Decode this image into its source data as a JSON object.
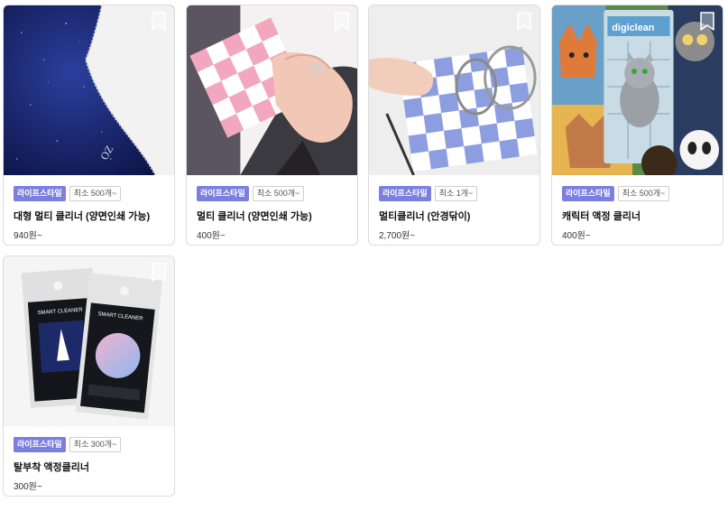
{
  "products": [
    {
      "category": "라이프스타일",
      "min_order": "최소 500개~",
      "title": "대형 멀티 클리너 (양면인쇄 가능)",
      "price": "940원~",
      "image_text": "OZ"
    },
    {
      "category": "라이프스타일",
      "min_order": "최소 500개~",
      "title": "멀티 클리너 (양면인쇄 가능)",
      "price": "400원~"
    },
    {
      "category": "라이프스타일",
      "min_order": "최소 1개~",
      "title": "멀티클리너 (안경닦이)",
      "price": "2,700원~"
    },
    {
      "category": "라이프스타일",
      "min_order": "최소 500개~",
      "title": "캐릭터 액정 클리너",
      "price": "400원~",
      "image_text": "digiclean"
    },
    {
      "category": "라이프스타일",
      "min_order": "최소 300개~",
      "title": "탈부착 액정클리너",
      "price": "300원~",
      "image_text": "SMART CLEANER"
    }
  ],
  "icons": {
    "bookmark": "bookmark-icon"
  },
  "colors": {
    "category_badge": "#7b7fe0",
    "card_border": "#dcdcdc"
  }
}
